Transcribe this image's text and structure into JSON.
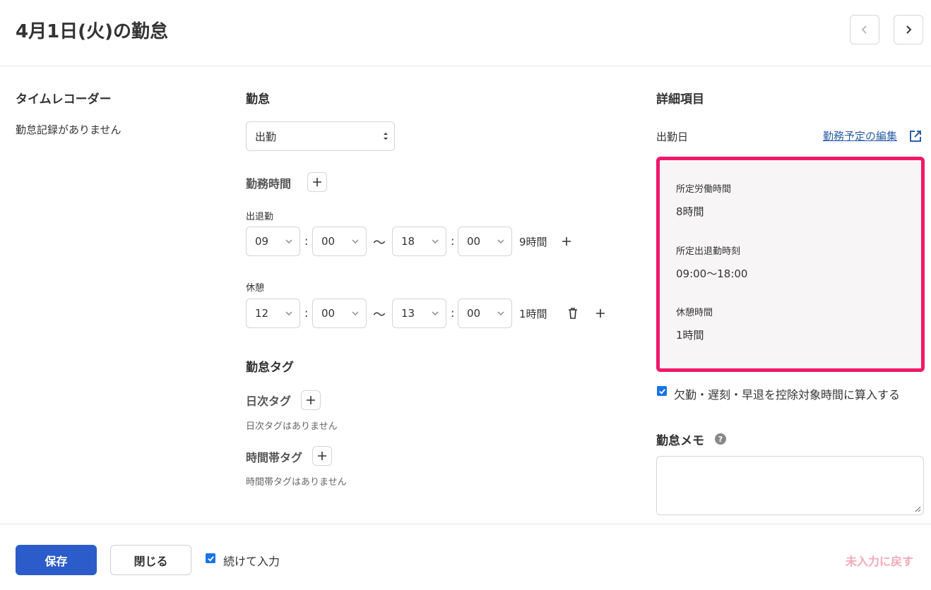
{
  "header": {
    "title": "4月1日(火)の勤怠"
  },
  "timerecorder": {
    "title": "タイムレコーダー",
    "empty": "勤怠記録がありません"
  },
  "attendance": {
    "title": "勤怠",
    "type_value": "出勤",
    "work_time_label": "勤務時間",
    "shift_label": "出退勤",
    "shift": {
      "start_h": "09",
      "start_m": "00",
      "end_h": "18",
      "end_m": "00",
      "duration": "9時間"
    },
    "break_label": "休憩",
    "break": {
      "start_h": "12",
      "start_m": "00",
      "end_h": "13",
      "end_m": "00",
      "duration": "1時間"
    },
    "colon": ":",
    "tilde": "〜"
  },
  "tags": {
    "title": "勤怠タグ",
    "daily_label": "日次タグ",
    "daily_empty": "日次タグはありません",
    "timeband_label": "時間帯タグ",
    "timeband_empty": "時間帯タグはありません"
  },
  "details": {
    "title": "詳細項目",
    "day_type": "出勤日",
    "edit_link": "勤務予定の編集",
    "schedule": {
      "work_hours_label": "所定労働時間",
      "work_hours_value": "8時間",
      "shift_label": "所定出退勤時刻",
      "shift_value": "09:00〜18:00",
      "break_label": "休憩時間",
      "break_value": "1時間"
    },
    "deduct_label": "欠勤・遅刻・早退を控除対象時間に算入する",
    "memo_label": "勤怠メモ",
    "help": "?"
  },
  "footer": {
    "save": "保存",
    "close": "閉じる",
    "continue_label": "続けて入力",
    "reset": "未入力に戻す"
  },
  "colors": {
    "accent": "#2b5cc9",
    "highlight": "#f0186b",
    "checkbox": "#1a73e8",
    "reset": "#f4a9b8"
  }
}
